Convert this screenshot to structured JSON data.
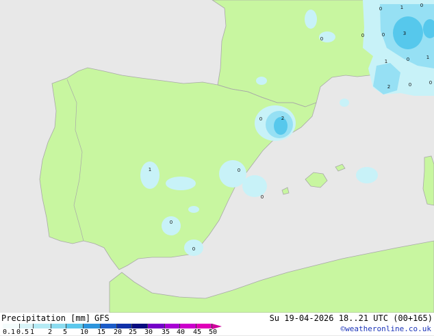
{
  "map": {
    "colors": {
      "sea": "#e8e8e8",
      "land": "#c8f6a0",
      "precip_light": "#c8f2f8",
      "precip_mid": "#96e0f4",
      "precip_heavy": "#56c8ec",
      "border": "#a8a8a8"
    },
    "labels": [
      "0",
      "1",
      "0",
      "3",
      "0",
      "0",
      "0",
      "1",
      "0",
      "1",
      "2",
      "0",
      "0",
      "0",
      "2",
      "1",
      "0",
      "0",
      "0",
      "0"
    ]
  },
  "footer": {
    "title": "Precipitation [mm]",
    "model": "GFS",
    "valid_time": "Su 19-04-2026 18..21 UTC (00+165)",
    "credit": "©weatheronline.co.uk",
    "scale_ticks": [
      "0.1",
      "0.5",
      "1",
      "2",
      "5",
      "10",
      "15",
      "20",
      "25",
      "30",
      "35",
      "40",
      "45",
      "50"
    ],
    "scale_colors": [
      "#f4fcfc",
      "#d8f4f8",
      "#b4eaf4",
      "#8cdcf0",
      "#5cc8ec",
      "#2c94dc",
      "#1c5cc8",
      "#1030a8",
      "#080c80",
      "#7400c8",
      "#a800d4",
      "#cc00cc",
      "#e000b8",
      "#d0009e"
    ]
  }
}
